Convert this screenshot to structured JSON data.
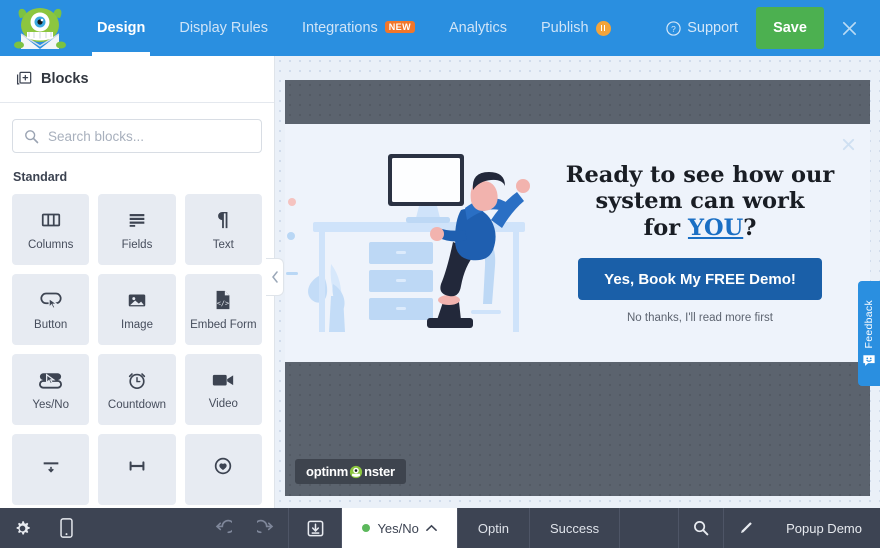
{
  "topbar": {
    "logo_icon": "optinmonster-monster-logo",
    "nav": [
      {
        "label": "Design",
        "active": true,
        "badge": null
      },
      {
        "label": "Display Rules",
        "active": false,
        "badge": null
      },
      {
        "label": "Integrations",
        "active": false,
        "badge": "NEW"
      },
      {
        "label": "Analytics",
        "active": false,
        "badge": null
      },
      {
        "label": "Publish",
        "active": false,
        "badge": "pause"
      }
    ],
    "support_label": "Support",
    "support_icon": "question-circle-icon",
    "save_label": "Save",
    "close_icon": "close-icon",
    "colors": {
      "bar": "#2a8fe0",
      "save": "#4cb050",
      "badge_new": "#f1762a",
      "badge_pause": "#f3a43a"
    }
  },
  "sidebar": {
    "header_label": "Blocks",
    "header_icon": "add-block-icon",
    "search_placeholder": "Search blocks...",
    "search_value": "",
    "search_icon": "search-icon",
    "section_title": "Standard",
    "blocks": [
      {
        "label": "Columns",
        "icon": "columns-icon"
      },
      {
        "label": "Fields",
        "icon": "fields-icon"
      },
      {
        "label": "Text",
        "icon": "paragraph-icon"
      },
      {
        "label": "Button",
        "icon": "button-cursor-icon"
      },
      {
        "label": "Image",
        "icon": "image-icon"
      },
      {
        "label": "Embed Form",
        "icon": "code-file-icon"
      },
      {
        "label": "Yes/No",
        "icon": "yesno-icon"
      },
      {
        "label": "Countdown",
        "icon": "alarm-clock-icon"
      },
      {
        "label": "Video",
        "icon": "video-camera-icon"
      },
      {
        "label": "",
        "icon": "divider-icon"
      },
      {
        "label": "",
        "icon": "spacer-icon"
      },
      {
        "label": "",
        "icon": "social-icon"
      }
    ],
    "collapse_icon": "chevron-left-icon"
  },
  "popup": {
    "close_icon": "close-icon",
    "headline_line1": "Ready to see how our",
    "headline_line2": "system can work",
    "headline_line3_pre": "for ",
    "headline_you": "YOU",
    "headline_line3_post": "?",
    "cta_label": "Yes, Book My FREE Demo!",
    "decline_label": "No thanks, I'll read more first",
    "watermark_pre": "optinm",
    "watermark_post": "nster",
    "watermark_icon": "monster-o-icon",
    "illustration": "person-at-desk-illustration",
    "colors": {
      "bg": "#eef3fb",
      "cta": "#1a5fa8",
      "accent": "#1a6fc4",
      "overlay": "#5b636e"
    }
  },
  "feedback": {
    "label": "Feedback",
    "icon": "smiley-message-icon"
  },
  "bottombar": {
    "settings_icon": "gear-icon",
    "mobile_icon": "mobile-icon",
    "undo_icon": "undo-icon",
    "redo_icon": "redo-icon",
    "save_device_icon": "save-to-device-icon",
    "tabs": [
      {
        "label": "Yes/No",
        "active": true,
        "dot": true,
        "caret": "chevron-up-icon"
      },
      {
        "label": "Optin",
        "active": false,
        "dot": false
      },
      {
        "label": "Success",
        "active": false,
        "dot": false
      }
    ],
    "search_icon": "search-icon",
    "edit_icon": "pencil-icon",
    "campaign_title": "Popup Demo"
  }
}
